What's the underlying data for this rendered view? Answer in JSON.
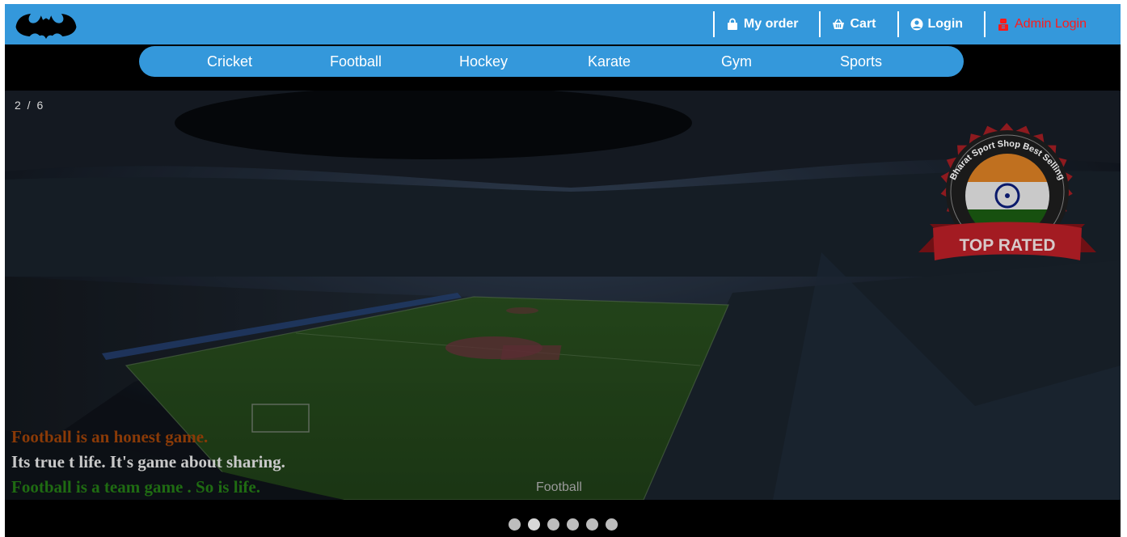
{
  "topnav": {
    "items": [
      {
        "label": "My order",
        "icon": "shopping-bag-icon"
      },
      {
        "label": "Cart",
        "icon": "basket-icon"
      },
      {
        "label": "Login",
        "icon": "user-circle-icon"
      },
      {
        "label": "Admin Login",
        "icon": "admin-user-icon"
      }
    ]
  },
  "categories": [
    "Cricket",
    "Football",
    "Hockey",
    "Karate",
    "Gym",
    "Sports"
  ],
  "slider": {
    "counter": "2 / 6",
    "captions": [
      "Football is an honest game.",
      "Its true t life.   It's game about sharing.",
      "Football is a team game . So is life."
    ],
    "slide_label": "Football",
    "badge": {
      "ring_text": "Bharat Sport Shop Best Selling",
      "ribbon_text": "TOP RATED"
    },
    "dot_count": 6,
    "active_index": 1
  },
  "colors": {
    "bar": "#3498db",
    "admin": "#ff1a1a",
    "caption_orange": "#8a3a07",
    "caption_green": "#1f6b12"
  }
}
